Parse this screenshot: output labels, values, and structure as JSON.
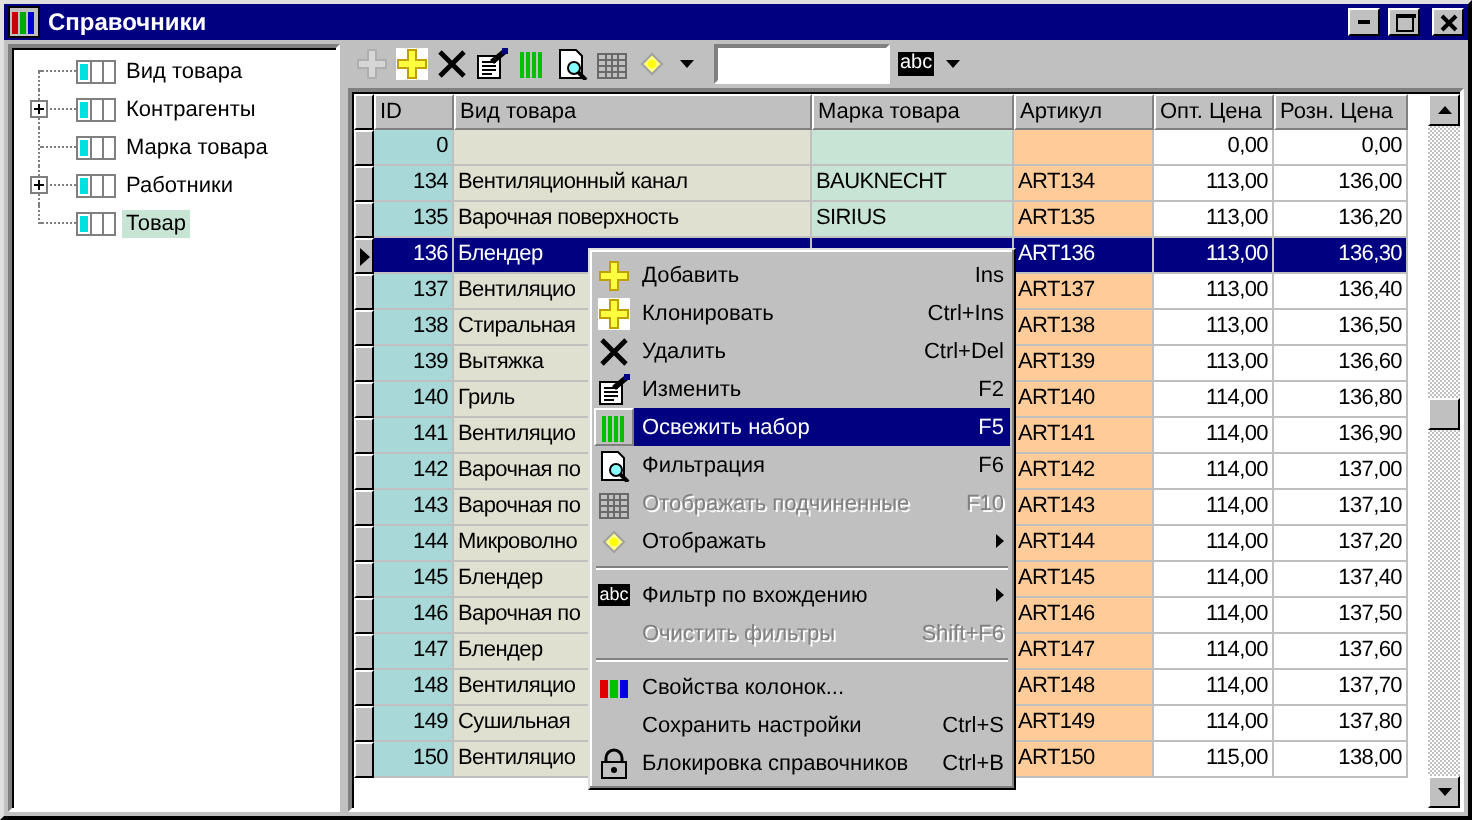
{
  "window": {
    "title": "Справочники"
  },
  "tree": {
    "items": [
      {
        "label": "Вид товара",
        "selected": false
      },
      {
        "label": "Контрагенты",
        "expanded": false,
        "selected": false
      },
      {
        "label": "Марка товара",
        "selected": false
      },
      {
        "label": "Работники",
        "expanded": false,
        "selected": false
      },
      {
        "label": "Товар",
        "selected": true
      }
    ]
  },
  "toolbar": {
    "buttons": [
      {
        "kind": "icon",
        "disabled": true
      },
      {
        "kind": "icon",
        "disabled": false
      },
      {
        "kind": "icon",
        "disabled": false
      },
      {
        "kind": "icon",
        "disabled": false
      },
      {
        "kind": "icon",
        "disabled": false
      },
      {
        "kind": "icon",
        "disabled": false
      },
      {
        "kind": "icon",
        "disabled": true
      },
      {
        "kind": "icon",
        "disabled": false
      },
      {
        "kind": "dropdown",
        "disabled": false
      }
    ],
    "filter_mode": {
      "label": "abc"
    }
  },
  "table": {
    "columns": [
      {
        "title": "ID",
        "color": "#a8d8d8"
      },
      {
        "title": "Вид товара",
        "color": "#e0e0d0"
      },
      {
        "title": "Марка товара",
        "color": "#c8e4d4"
      },
      {
        "title": "Артикул",
        "color": "#ffcc99"
      },
      {
        "title": "Опт. Цена",
        "color": "#ffffff"
      },
      {
        "title": "Розн. Цена",
        "color": "#ffffff"
      }
    ],
    "rows": [
      {
        "selected": false,
        "cells": [
          "0",
          null,
          null,
          null,
          "0,00",
          "0,00"
        ]
      },
      {
        "selected": false,
        "cells": [
          "134",
          "Вентиляционный канал",
          "BAUKNECHT",
          "ART134",
          "113,00",
          "136,00"
        ]
      },
      {
        "selected": false,
        "cells": [
          "135",
          "Варочная поверхность",
          "SIRIUS",
          "ART135",
          "113,00",
          "136,20"
        ]
      },
      {
        "selected": true,
        "cells": [
          "136",
          "Блендер",
          null,
          "ART136",
          "113,00",
          "136,30"
        ]
      },
      {
        "selected": false,
        "cells": [
          "137",
          "Вентиляцио",
          null,
          "ART137",
          "113,00",
          "136,40"
        ]
      },
      {
        "selected": false,
        "cells": [
          "138",
          "Стиральная",
          null,
          "ART138",
          "113,00",
          "136,50"
        ]
      },
      {
        "selected": false,
        "cells": [
          "139",
          "Вытяжка",
          null,
          "ART139",
          "113,00",
          "136,60"
        ]
      },
      {
        "selected": false,
        "cells": [
          "140",
          "Гриль",
          null,
          "ART140",
          "114,00",
          "136,80"
        ]
      },
      {
        "selected": false,
        "cells": [
          "141",
          "Вентиляцио",
          null,
          "ART141",
          "114,00",
          "136,90"
        ]
      },
      {
        "selected": false,
        "cells": [
          "142",
          "Варочная по",
          null,
          "ART142",
          "114,00",
          "137,00"
        ]
      },
      {
        "selected": false,
        "cells": [
          "143",
          "Варочная по",
          null,
          "ART143",
          "114,00",
          "137,10"
        ]
      },
      {
        "selected": false,
        "cells": [
          "144",
          "Микроволно",
          null,
          "ART144",
          "114,00",
          "137,20"
        ]
      },
      {
        "selected": false,
        "cells": [
          "145",
          "Блендер",
          null,
          "ART145",
          "114,00",
          "137,40"
        ]
      },
      {
        "selected": false,
        "cells": [
          "146",
          "Варочная по",
          null,
          "ART146",
          "114,00",
          "137,50"
        ]
      },
      {
        "selected": false,
        "cells": [
          "147",
          "Блендер",
          null,
          "ART147",
          "114,00",
          "137,60"
        ]
      },
      {
        "selected": false,
        "cells": [
          "148",
          "Вентиляцио",
          null,
          "ART148",
          "114,00",
          "137,70"
        ]
      },
      {
        "selected": false,
        "cells": [
          "149",
          "Сушильная",
          null,
          "ART149",
          "114,00",
          "137,80"
        ]
      },
      {
        "selected": false,
        "cells": [
          "150",
          "Вентиляцио",
          null,
          "ART150",
          "115,00",
          "138,00"
        ]
      }
    ]
  },
  "context_menu": {
    "items": [
      {
        "kind": "item",
        "label": "Добавить",
        "shortcut": "Ins",
        "disabled": false,
        "selected": false,
        "submenu": false
      },
      {
        "kind": "item",
        "label": "Клонировать",
        "shortcut": "Ctrl+Ins",
        "disabled": false,
        "selected": false,
        "submenu": false
      },
      {
        "kind": "item",
        "label": "Удалить",
        "shortcut": "Ctrl+Del",
        "disabled": false,
        "selected": false,
        "submenu": false
      },
      {
        "kind": "item",
        "label": "Изменить",
        "shortcut": "F2",
        "disabled": false,
        "selected": false,
        "submenu": false
      },
      {
        "kind": "item",
        "label": "Освежить набор",
        "shortcut": "F5",
        "disabled": false,
        "selected": true,
        "submenu": false
      },
      {
        "kind": "item",
        "label": "Фильтрация",
        "shortcut": "F6",
        "disabled": false,
        "selected": false,
        "submenu": false
      },
      {
        "kind": "item",
        "label": "Отображать подчиненные",
        "shortcut": "F10",
        "disabled": true,
        "selected": false,
        "submenu": false
      },
      {
        "kind": "item",
        "label": "Отображать",
        "disabled": false,
        "selected": false,
        "submenu": true
      },
      {
        "kind": "separator"
      },
      {
        "kind": "item",
        "label": "Фильтр по вхождению",
        "icon_text": "abc",
        "disabled": false,
        "selected": false,
        "submenu": true
      },
      {
        "kind": "item",
        "label": "Очистить фильтры",
        "shortcut": "Shift+F6",
        "disabled": true,
        "selected": false,
        "submenu": false
      },
      {
        "kind": "separator"
      },
      {
        "kind": "item",
        "label": "Свойства колонок...",
        "disabled": false,
        "selected": false,
        "submenu": false
      },
      {
        "kind": "item",
        "label": "Сохранить настройки",
        "shortcut": "Ctrl+S",
        "disabled": false,
        "selected": false,
        "submenu": false
      },
      {
        "kind": "item",
        "label": "Блокировка справочников",
        "shortcut": "Ctrl+B",
        "disabled": false,
        "selected": false,
        "submenu": false
      }
    ]
  }
}
